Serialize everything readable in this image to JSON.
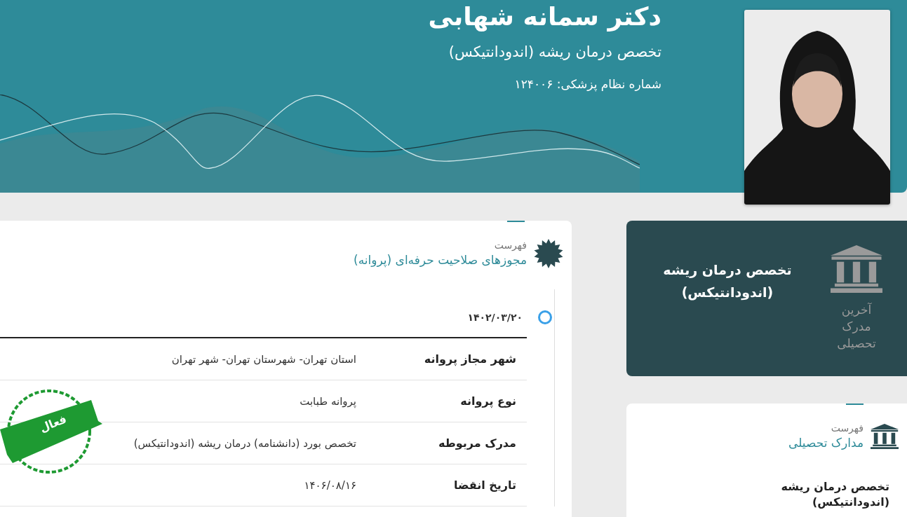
{
  "header": {
    "name": "دکتر سمانه شهابی",
    "specialty": "تخصص درمان ریشه (اندودانتیکس)",
    "registration": "شماره نظام پزشکی: ۱۲۴۰۰۶"
  },
  "licenses": {
    "caption": "فهرست",
    "title": "مجوزهای صلاحیت حرفه‌ای (پروانه)",
    "entries": [
      {
        "date": "۱۴۰۲/۰۳/۲۰",
        "stamp": "فعال",
        "rows": [
          {
            "label": "شهر مجاز پروانه",
            "value": "استان تهران- شهرستان تهران- شهر تهران"
          },
          {
            "label": "نوع پروانه",
            "value": "پروانه طبابت"
          },
          {
            "label": "مدرک مربوطه",
            "value": "تخصص بورد (دانشنامه) درمان ریشه (اندودانتیکس)"
          },
          {
            "label": "تاریخ انقضا",
            "value": "۱۴۰۶/۰۸/۱۶"
          }
        ]
      }
    ]
  },
  "latest_degree": {
    "label": "آخرین مدرک تحصیلی",
    "title": "تخصص درمان ریشه (اندودانتیکس)"
  },
  "degrees": {
    "caption": "فهرست",
    "title": "مدارک تحصیلی",
    "items": [
      "تخصص درمان ریشه (اندودانتیکس)"
    ]
  }
}
